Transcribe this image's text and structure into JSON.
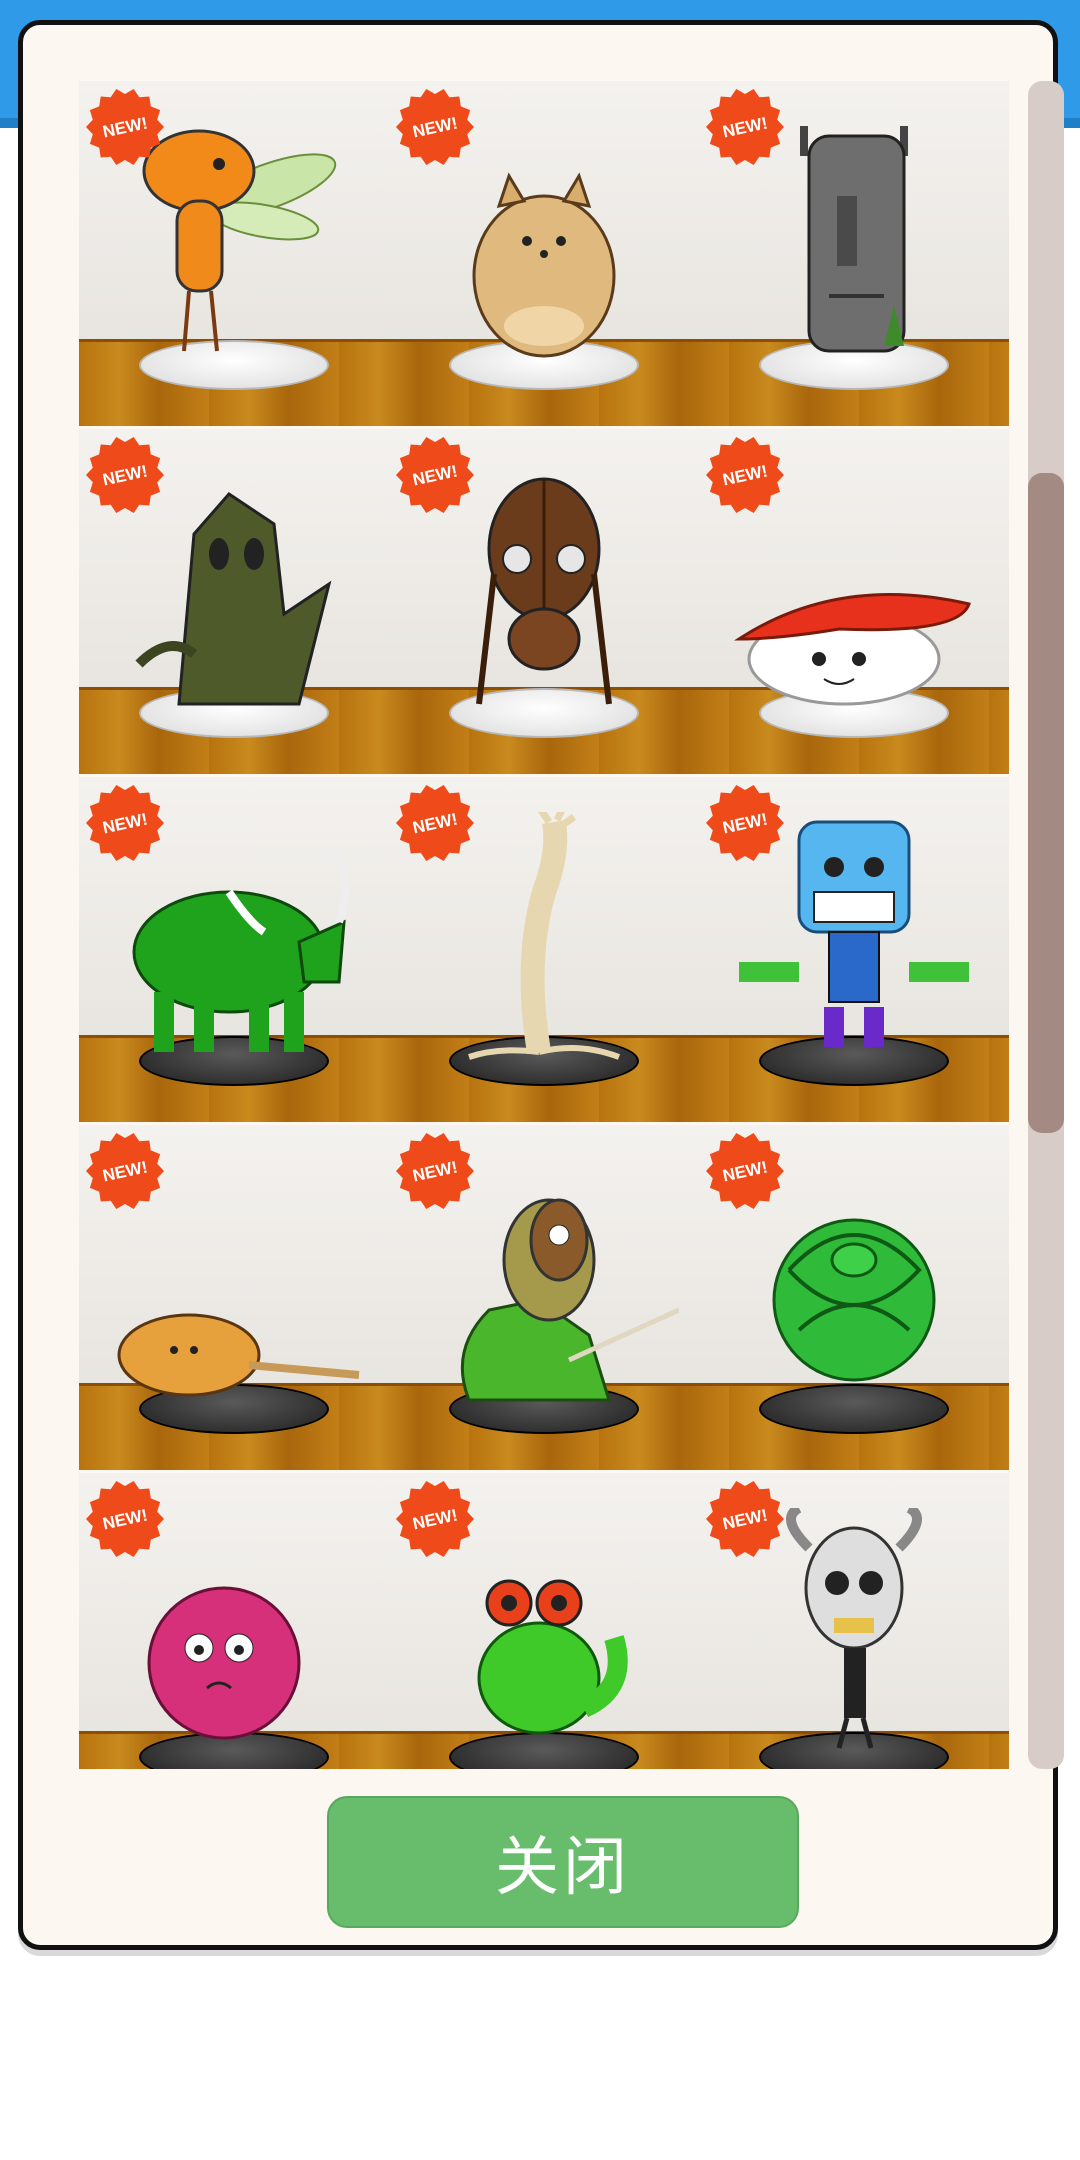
{
  "badge_text": "NEW!",
  "close_button": {
    "label": "关闭"
  },
  "colors": {
    "badge": "#ef4b1a",
    "button": "#67bd6c",
    "shelf_wood": "#b8730f",
    "topbar": "#2f9ae8"
  },
  "rows": [
    [
      {
        "name": "orange-winged-creature",
        "pedestal": "white"
      },
      {
        "name": "hamster-creature",
        "pedestal": "white"
      },
      {
        "name": "moai-statue",
        "pedestal": "white"
      }
    ],
    [
      {
        "name": "tree-monster",
        "pedestal": "white"
      },
      {
        "name": "beetle-creature",
        "pedestal": "white"
      },
      {
        "name": "sushi-creature",
        "pedestal": "white"
      }
    ],
    [
      {
        "name": "green-rhino",
        "pedestal": "black"
      },
      {
        "name": "arm-root-creature",
        "pedestal": "black"
      },
      {
        "name": "blue-cube-robot",
        "pedestal": "black"
      }
    ],
    [
      {
        "name": "corndog-creature",
        "pedestal": "black"
      },
      {
        "name": "masked-goblin",
        "pedestal": "black"
      },
      {
        "name": "green-snake-knot",
        "pedestal": "black"
      }
    ],
    [
      {
        "name": "pink-fuzzball",
        "pedestal": "black"
      },
      {
        "name": "green-frog",
        "pedestal": "black"
      },
      {
        "name": "horned-skull-figure",
        "pedestal": "black"
      }
    ]
  ]
}
